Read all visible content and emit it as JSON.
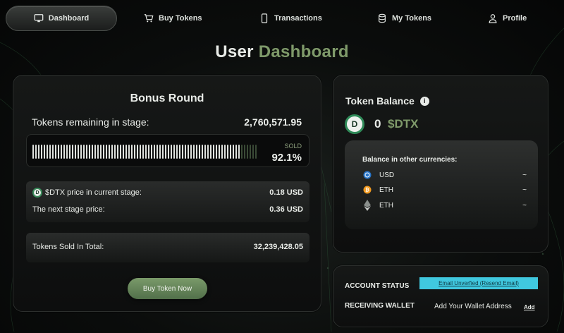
{
  "nav": {
    "items": [
      {
        "label": "Dashboard",
        "icon": "monitor-icon",
        "active": true
      },
      {
        "label": "Buy Tokens",
        "icon": "cart-icon",
        "active": false
      },
      {
        "label": "Transactions",
        "icon": "phone-icon",
        "active": false
      },
      {
        "label": "My Tokens",
        "icon": "database-icon",
        "active": false
      },
      {
        "label": "Profile",
        "icon": "user-icon",
        "active": false
      }
    ]
  },
  "page": {
    "title_main": "User",
    "title_accent": "Dashboard"
  },
  "bonus": {
    "title": "Bonus Round",
    "remaining_label": "Tokens remaining in stage:",
    "remaining_value": "2,760,571.95",
    "progress": 0.921,
    "sold_label": "SOLD",
    "sold_value": "92.1%",
    "price_label": "$DTX price in current stage:",
    "price_value": "0.18 USD",
    "next_price_label": "The next stage price:",
    "next_price_value": "0.36 USD",
    "total_label": "Tokens Sold In Total:",
    "total_value": "32,239,428.05",
    "buy_button": "Buy Token Now"
  },
  "balance": {
    "title": "Token Balance",
    "amount": "0",
    "symbol": "$DTX",
    "other_title": "Balance in other currencies:",
    "currencies": [
      {
        "name": "USD",
        "icon": "usd-coin-icon",
        "value": "~"
      },
      {
        "name": "ETH",
        "icon": "bitcoin-orange-icon",
        "value": "~"
      },
      {
        "name": "ETH",
        "icon": "ethereum-icon",
        "value": "~"
      }
    ]
  },
  "account": {
    "status_label": "ACCOUNT STATUS",
    "status_badge": "Email Unverfied (Resend Email)",
    "wallet_label": "RECEIVING WALLET",
    "wallet_text": "Add Your Wallet Address",
    "wallet_add": "Add"
  },
  "colors": {
    "accent": "#7f9a6a",
    "button": "#6a8a5c",
    "badge": "#40c8df"
  }
}
